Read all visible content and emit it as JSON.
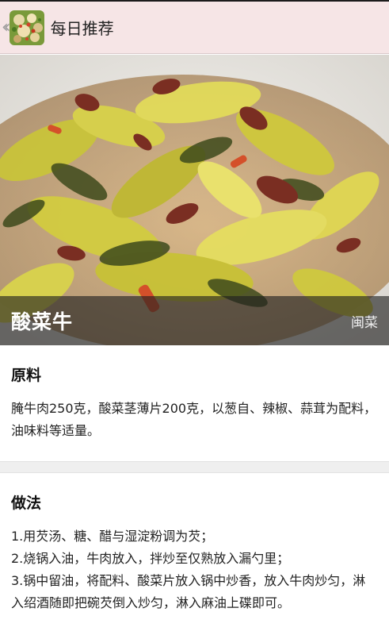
{
  "header": {
    "title": "每日推荐",
    "back_icon": "chevron-double-left-icon",
    "app_icon": "dish-thumbnail-icon"
  },
  "hero": {
    "dish_name": "酸菜牛",
    "cuisine": "闽菜"
  },
  "ingredients": {
    "title": "原料",
    "text": "腌牛肉250克，酸菜茎薄片200克，以葱自、辣椒、蒜茸为配料，油味料等适量。"
  },
  "method": {
    "title": "做法",
    "steps": [
      "1.用芡汤、糖、醋与湿淀粉调为芡；",
      "2.烧锅入油，牛肉放入，拌炒至仅熟放入漏勺里；",
      "3.锅中留油，将配料、酸菜片放入锅中炒香，放入牛肉炒匀，淋入绍酒随即把碗芡倒入炒匀，淋入麻油上碟即可。"
    ]
  },
  "colors": {
    "app_bar": "#f6e5e6",
    "overlay": "#1e1e1e",
    "divider": "#efefef"
  }
}
